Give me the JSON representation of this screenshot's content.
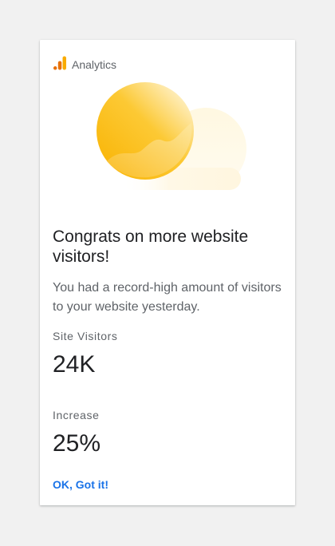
{
  "brand": {
    "name": "Analytics",
    "icon": "analytics-bar-chart-icon",
    "colors": [
      "#e8710a",
      "#f9ab00"
    ]
  },
  "illustration": {
    "icon": "sun-cloud-illustration",
    "colors": [
      "#fbbc04",
      "#fde293",
      "#fef7e0"
    ]
  },
  "message": {
    "title": "Congrats on more website visitors!",
    "description": "You had a record-high amount of visitors to your website yesterday."
  },
  "metrics": [
    {
      "label": "Site Visitors",
      "value": "24K"
    },
    {
      "label": "Increase",
      "value": "25%"
    }
  ],
  "actions": {
    "ok_label": "OK, Got it!"
  },
  "theme": {
    "accent": "#1a73e8",
    "background": "#f1f1f1",
    "card": "#ffffff"
  }
}
